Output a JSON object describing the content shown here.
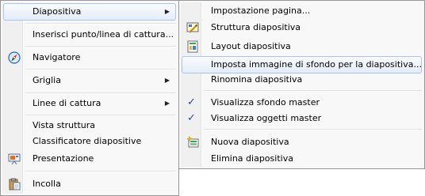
{
  "left_menu": {
    "items": [
      {
        "label": "Diapositiva",
        "has_submenu": true
      },
      {
        "label": "Inserisci punto/linea di cattura..."
      },
      {
        "label": "Navigatore",
        "icon": "compass-icon"
      },
      {
        "label": "Griglia",
        "has_submenu": true
      },
      {
        "label": "Linee di cattura",
        "has_submenu": true
      },
      {
        "label": "Vista struttura"
      },
      {
        "label": "Classificatore diapositive"
      },
      {
        "label": "Presentazione",
        "icon": "projector-icon"
      },
      {
        "label": "Incolla",
        "icon": "paste-icon"
      }
    ]
  },
  "right_menu": {
    "items": [
      {
        "label": "Impostazione pagina..."
      },
      {
        "label": "Struttura diapositiva",
        "icon": "slide-design-icon"
      },
      {
        "label": "Layout diapositiva",
        "icon": "slide-layout-icon"
      },
      {
        "label": "Imposta immagine di sfondo per la diapositiva..."
      },
      {
        "label": "Rinomina diapositiva"
      },
      {
        "label": "Visualizza sfondo master",
        "checked": true
      },
      {
        "label": "Visualizza oggetti master",
        "checked": true
      },
      {
        "label": "Nuova diapositiva",
        "icon": "new-slide-icon"
      },
      {
        "label": "Elimina diapositiva"
      }
    ]
  },
  "glyphs": {
    "submenu_arrow": "▶",
    "check": "✓"
  }
}
